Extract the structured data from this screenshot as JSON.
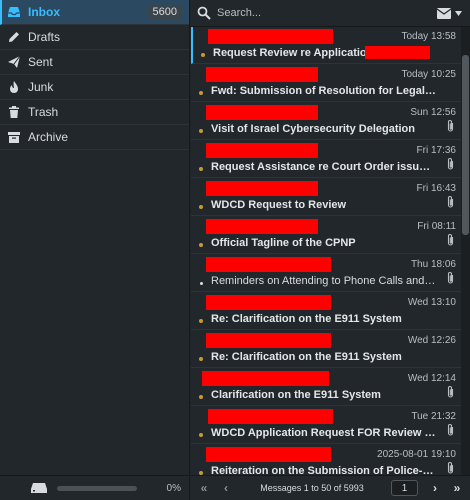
{
  "sidebar": {
    "folders": [
      {
        "label": "Inbox",
        "count": "5600",
        "icon": "inbox-icon"
      },
      {
        "label": "Drafts",
        "icon": "pencil-icon"
      },
      {
        "label": "Sent",
        "icon": "paper-plane-icon"
      },
      {
        "label": "Junk",
        "icon": "fire-icon"
      },
      {
        "label": "Trash",
        "icon": "trash-icon"
      },
      {
        "label": "Archive",
        "icon": "archive-box-icon"
      }
    ],
    "quota": {
      "text": "0%",
      "fraction": 0.0
    }
  },
  "search": {
    "placeholder": "Search..."
  },
  "messages": [
    {
      "date": "Today 13:58",
      "subject": "Request Review re Application for ",
      "unread": true,
      "attachment": false
    },
    {
      "date": "Today 10:25",
      "subject": "Fwd: Submission of Resolution for Legal Evaluation",
      "unread": true,
      "attachment": false
    },
    {
      "date": "Sun 12:56",
      "subject": "Visit of Israel Cybersecurity Delegation",
      "unread": true,
      "attachment": true
    },
    {
      "date": "Fri 17:36",
      "subject": "Request Assistance re Court Order issued by RTC Branch",
      "unread": true,
      "attachment": true
    },
    {
      "date": "Fri 16:43",
      "subject": "WDCD Request to Review",
      "unread": true,
      "attachment": true
    },
    {
      "date": "Fri 08:11",
      "subject": "Official Tagline of the CPNP",
      "unread": true,
      "attachment": true
    },
    {
      "date": "Thu 18:06",
      "subject": "Reminders on Attending to Phone Calls and Messages",
      "unread": false,
      "attachment": true
    },
    {
      "date": "Wed 13:10",
      "subject": "Re: Clarification on the E911 System",
      "unread": true,
      "attachment": false
    },
    {
      "date": "Wed 12:26",
      "subject": "Re: Clarification on the E911 System",
      "unread": true,
      "attachment": false
    },
    {
      "date": "Wed 12:14",
      "subject": "Clarification on the E911 System",
      "unread": true,
      "attachment": true
    },
    {
      "date": "Tue 21:32",
      "subject": "WDCD Application Request FOR Review to LAD (GSO)",
      "unread": true,
      "attachment": true
    },
    {
      "date": "2025-08-01 19:10",
      "subject": "Reiteration on the Submission of Police-Community Relations",
      "unread": true,
      "attachment": true
    }
  ],
  "pager": {
    "info": "Messages 1 to 50 of 5993",
    "page": "1"
  },
  "colors": {
    "accent": "#37beff",
    "unread_dot": "#c79a2e",
    "redaction": "#ff0000"
  }
}
